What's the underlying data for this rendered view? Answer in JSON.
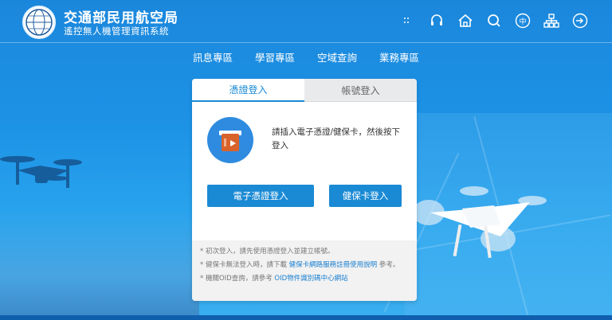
{
  "header": {
    "title": "交通部民用航空局",
    "subtitle": "遙控無人機管理資訊系統",
    "icons": [
      {
        "name": "sitemap-dots-icon"
      },
      {
        "name": "headset-icon"
      },
      {
        "name": "home-icon"
      },
      {
        "name": "search-icon"
      },
      {
        "name": "language-icon",
        "label": "中"
      },
      {
        "name": "site-map-icon"
      },
      {
        "name": "login-icon"
      }
    ]
  },
  "nav": {
    "items": [
      "訊息專區",
      "學習專區",
      "空域查詢",
      "業務專區"
    ]
  },
  "login": {
    "tabs": [
      "憑證登入",
      "帳號登入"
    ],
    "instruction": "請插入電子憑證/健保卡，然後按下登入",
    "buttons": {
      "cert_login": "電子憑證登入",
      "health_card_login": "健保卡登入"
    },
    "notes": {
      "note1": "* 初次登入，請先使用憑證登入並建立帳號。",
      "note2_prefix": "* 健保卡無法登入時，請下載",
      "note2_link": "健保卡網路服務註冊使用說明",
      "note2_suffix": "參考。",
      "note3_prefix": "* 機關OID查詢，請參考",
      "note3_link": "OID物件識別碼中心網站"
    }
  },
  "colors": {
    "accent": "#1a8ad4",
    "background": "#1d93e6",
    "tab_inactive": "#e9eaec"
  }
}
